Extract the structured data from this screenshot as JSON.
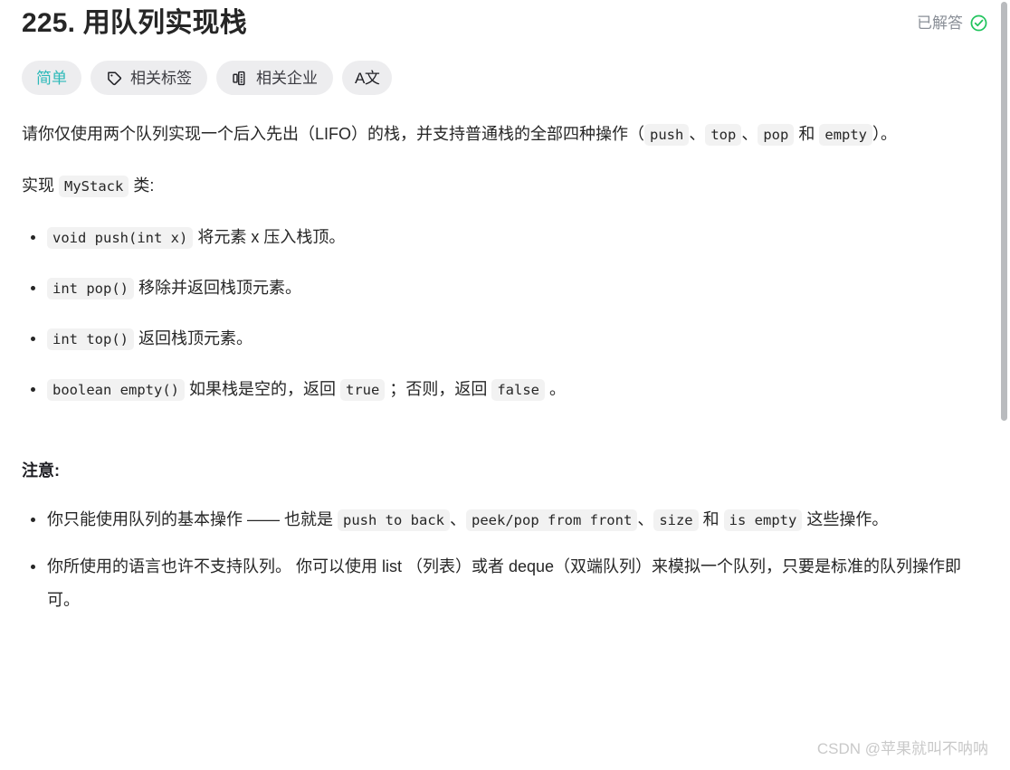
{
  "header": {
    "problem_number": "225.",
    "title": "用队列实现栈",
    "full_title": "225. 用队列实现栈",
    "status_label": "已解答",
    "status_icon": "check-circle-icon",
    "status_color": "#21c45d"
  },
  "chips": [
    {
      "label": "简单",
      "icon": null,
      "name": "difficulty-chip",
      "color": "#2cb9b9"
    },
    {
      "label": "相关标签",
      "icon": "tag-icon",
      "name": "related-tags-chip"
    },
    {
      "label": "相关企业",
      "icon": "company-icon",
      "name": "related-companies-chip"
    },
    {
      "label": "A文",
      "icon": "translate-icon",
      "name": "translate-chip"
    }
  ],
  "description": {
    "intro_part1": "请你仅使用两个队列实现一个后入先出（LIFO）的栈，并支持普通栈的全部四种操作（",
    "code_push": "push",
    "sep1": "、",
    "code_top": "top",
    "sep2": "、",
    "code_pop": "pop",
    "and_word": " 和 ",
    "code_empty": "empty",
    "intro_tail": "）。",
    "implement_prefix": "实现 ",
    "implement_code": "MyStack",
    "implement_suffix": " 类:"
  },
  "methods": [
    {
      "code": "void push(int x)",
      "text": " 将元素 x 压入栈顶。"
    },
    {
      "code": "int pop()",
      "text": " 移除并返回栈顶元素。"
    },
    {
      "code": "int top()",
      "text": " 返回栈顶元素。"
    },
    {
      "code": "boolean empty()",
      "text_before": " 如果栈是空的，返回 ",
      "code_true": "true",
      "text_mid": " ；否则，返回 ",
      "code_false": "false",
      "text_after": " 。"
    }
  ],
  "notes": {
    "title": "注意:",
    "item1": {
      "p1": "你只能使用队列的基本操作 —— 也就是 ",
      "c1": "push to back",
      "s1": "、",
      "c2": "peek/pop from front",
      "s2": "、",
      "c3": "size",
      "s3": " 和 ",
      "c4": "is empty",
      "p2": " 这些操作。"
    },
    "item2": "你所使用的语言也许不支持队列。 你可以使用 list （列表）或者 deque（双端队列）来模拟一个队列，只要是标准的队列操作即可。"
  },
  "watermark": "CSDN @苹果就叫不呐呐",
  "scrollbar": {
    "thumb_color": "#b9bbbe"
  }
}
